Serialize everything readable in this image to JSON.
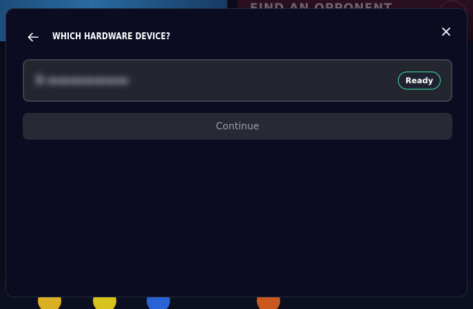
{
  "background": {
    "heading_text": "FIND AN OPPONENT"
  },
  "modal": {
    "title": "WHICH HARDWARE DEVICE?",
    "back_icon": "arrow-left-icon",
    "close_icon": "close-icon",
    "device": {
      "name": "",
      "status": "Ready"
    },
    "continue_label": "Continue"
  },
  "colors": {
    "modal_bg": "#0b0c22",
    "row_bg": "#23252f",
    "ready_border": "#3ee6a8",
    "button_bg": "#272a35",
    "button_text": "#9a9dab"
  }
}
